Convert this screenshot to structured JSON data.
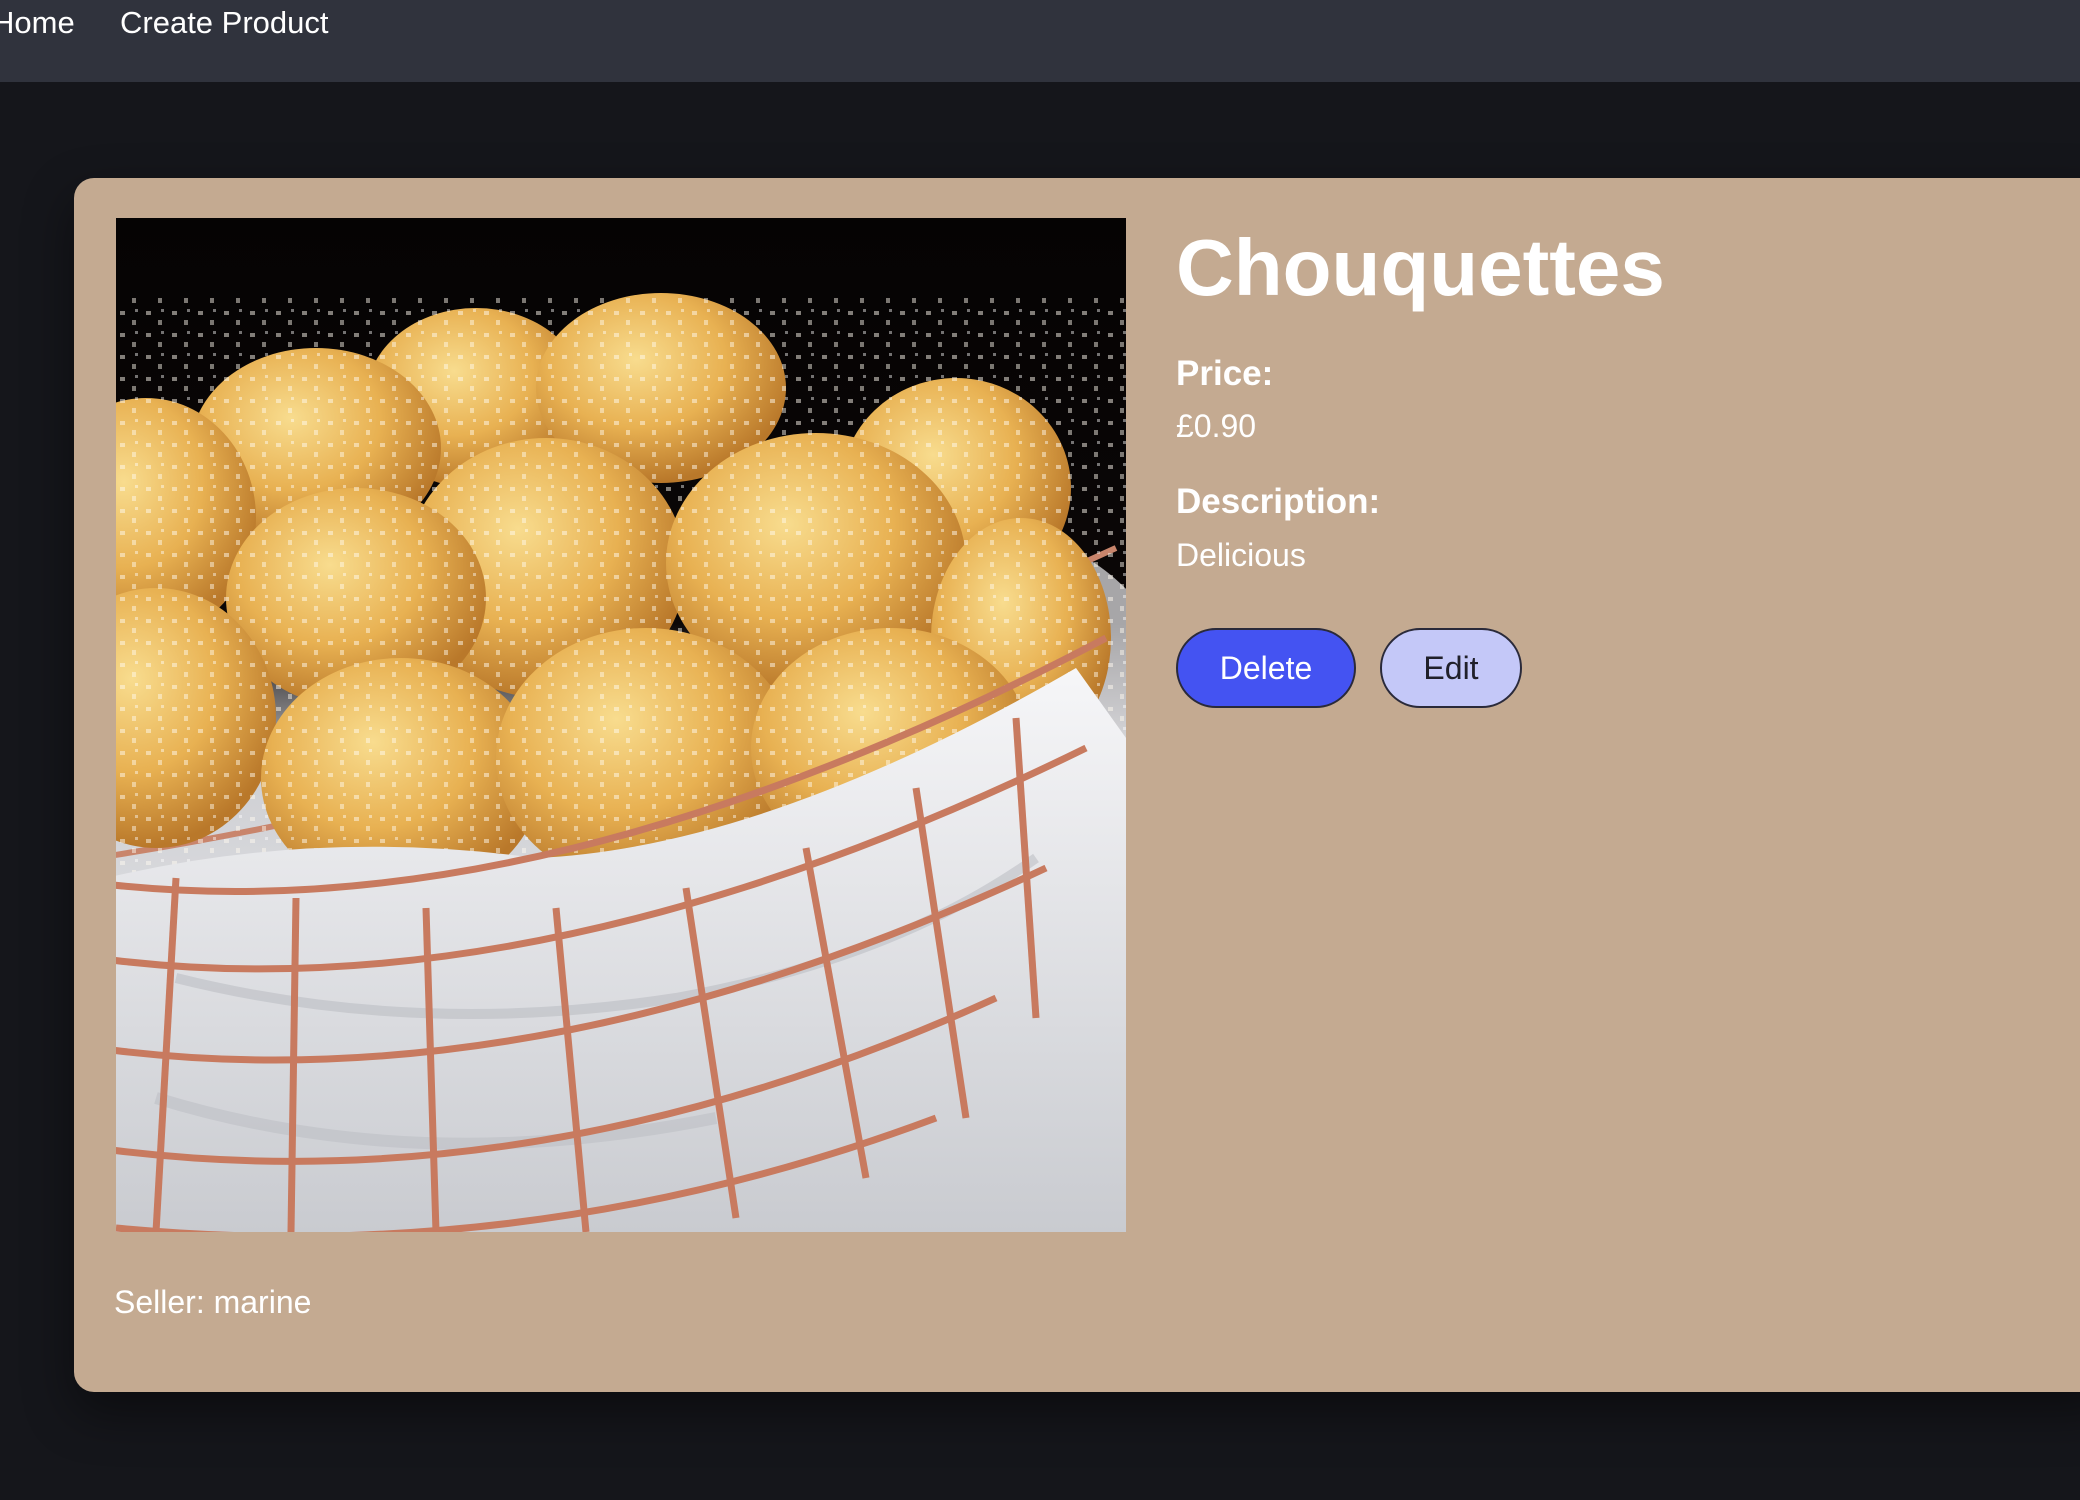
{
  "nav": {
    "home_label": "Home",
    "create_label": "Create Product"
  },
  "product": {
    "title": "Chouquettes",
    "price_label": "Price:",
    "price_value": "£0.90",
    "description_label": "Description:",
    "description_value": "Delicious",
    "seller_text": "Seller: marine",
    "image_alt": "Basket of chouquettes"
  },
  "actions": {
    "delete_label": "Delete",
    "edit_label": "Edit"
  },
  "colors": {
    "page_background": "#15161b",
    "navbar_background": "#30333d",
    "card_background": "#c4aa91",
    "delete_button": "#4453f2",
    "edit_button": "#c4c8f8"
  }
}
